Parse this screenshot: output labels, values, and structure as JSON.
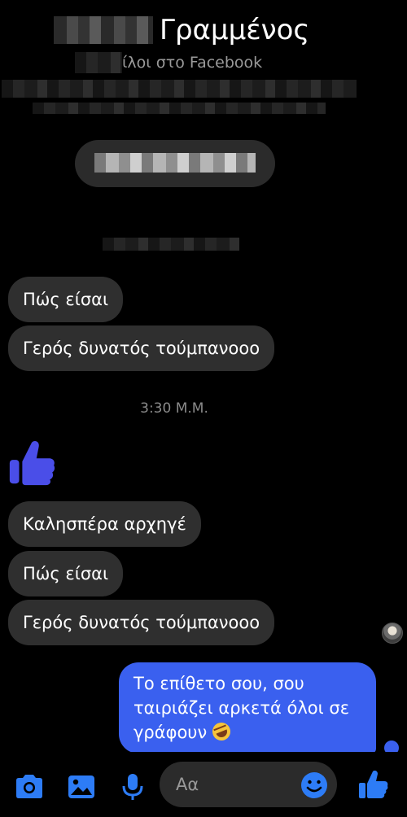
{
  "header": {
    "name": "Γραμμένος",
    "subtitle": "ίλοι στο Facebook"
  },
  "messages": {
    "incoming_1": "Πώς είσαι",
    "incoming_2": "Γερός δυνατός τούμπανοοο",
    "timestamp": "3:30 Μ.Μ.",
    "incoming_3": "Καλησπέρα αρχηγέ",
    "incoming_4": "Πώς είσαι",
    "incoming_5": "Γερός δυνατός τούμπανοοο",
    "outgoing_1": "Το επίθετο σου, σου ταιριάζει αρκετά όλοι σε γράφουν",
    "outgoing_1_emoji": "rolling-on-the-floor-laughing-emoji"
  },
  "composer": {
    "placeholder": "Αα",
    "icons": [
      "camera-icon",
      "image-icon",
      "microphone-icon",
      "emoji-icon",
      "thumbs-up-icon"
    ]
  },
  "colors": {
    "background": "#000000",
    "incoming_bubble": "#2f2f2f",
    "outgoing_bubble": "#3a60ef",
    "accent": "#2d7cf6",
    "like_sticker": "#4a4ee8"
  }
}
